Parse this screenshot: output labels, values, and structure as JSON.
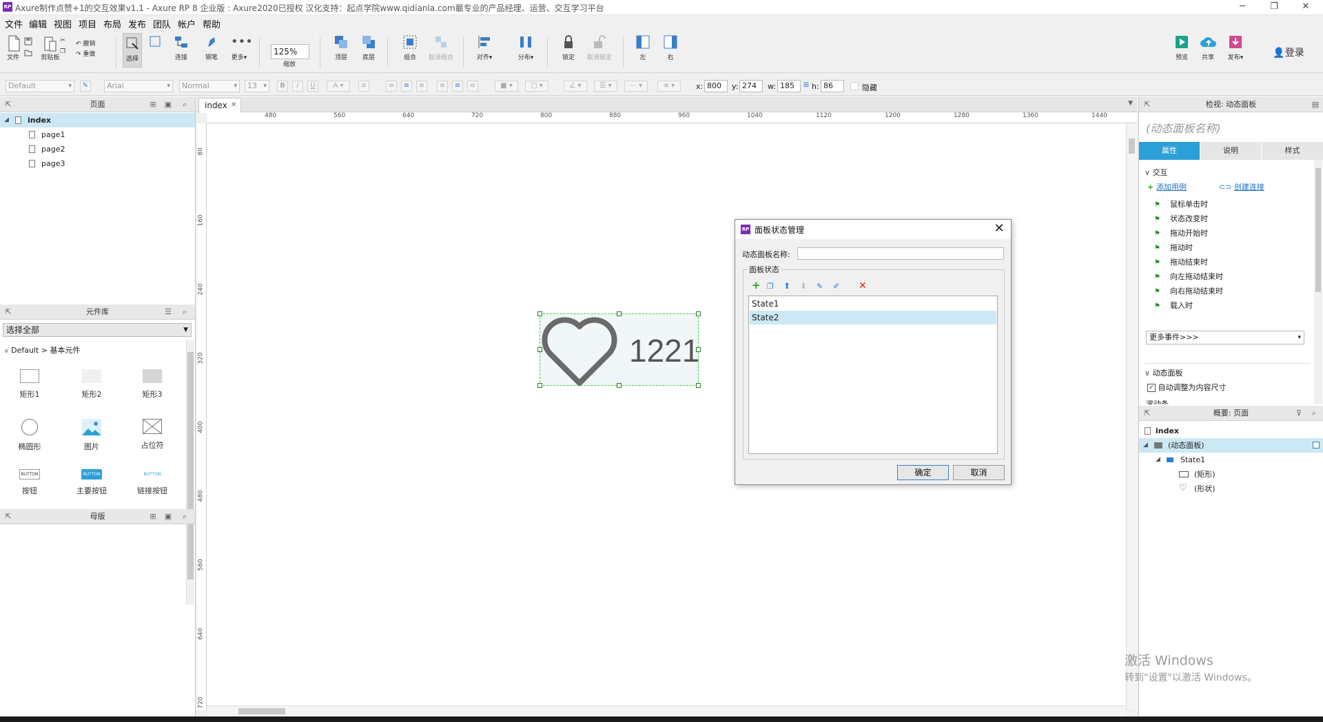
{
  "window": {
    "title": "Axure制作点赞+1的交互效果v1.1 - Axure RP 8 企业版 : Axure2020已授权 汉化支持：起点学院www.qidianla.com最专业的产品经理、运营、交互学习平台",
    "logo": "RP"
  },
  "menu": [
    "文件",
    "编辑",
    "视图",
    "项目",
    "布局",
    "发布",
    "团队",
    "帐户",
    "帮助"
  ],
  "toolbar": {
    "file": "文件",
    "clipboard": "剪贴板",
    "undo": "撤销",
    "redo": "重做",
    "select": "选择",
    "connect": "连接",
    "pen": "钢笔",
    "more": "更多▾",
    "zoom_value": "125%",
    "zoom": "缩放",
    "top": "顶层",
    "bottom": "底层",
    "group": "组合",
    "ungroup": "取消组合",
    "align": "对齐▾",
    "distribute": "分布▾",
    "lock": "锁定",
    "unlock": "取消锁定",
    "left": "左",
    "right": "右",
    "preview": "预览",
    "share": "共享",
    "publish": "发布▾",
    "login": "登录"
  },
  "format": {
    "style": "Default",
    "font": "Arial",
    "weight": "Normal",
    "size": "13",
    "x_label": "x:",
    "x": "800",
    "y_label": "y:",
    "y": "274",
    "w_label": "w:",
    "w": "185",
    "h_label": "h:",
    "h": "86",
    "hidden": "隐藏"
  },
  "pages": {
    "header": "页面",
    "items": [
      "index",
      "page1",
      "page2",
      "page3"
    ]
  },
  "library": {
    "header": "元件库",
    "filter": "选择全部",
    "group": "Default > 基本元件",
    "widgets": [
      "矩形1",
      "矩形2",
      "矩形3",
      "椭圆形",
      "图片",
      "占位符",
      "按钮",
      "主要按钮",
      "链接按钮"
    ],
    "button_text": "BUTTON"
  },
  "masters": {
    "header": "母版"
  },
  "canvas": {
    "tab": "index",
    "ruler_top": [
      "480",
      "560",
      "640",
      "720",
      "800",
      "880",
      "960",
      "1040",
      "1120",
      "1200",
      "1280",
      "1360",
      "1440"
    ],
    "ruler_left": [
      "80",
      "160",
      "240",
      "320",
      "400",
      "480",
      "560",
      "640",
      "720"
    ],
    "like_count": "1221"
  },
  "dialog": {
    "title": "面板状态管理",
    "name_label": "动态面板名称:",
    "name_value": "",
    "group_label": "面板状态",
    "states": [
      "State1",
      "State2"
    ],
    "selected_state": "State2",
    "ok": "确定",
    "cancel": "取消"
  },
  "inspector": {
    "header": "检视: 动态面板",
    "name_placeholder": "(动态面板名称)",
    "tabs": [
      "属性",
      "说明",
      "样式"
    ],
    "interaction": "交互",
    "add_case": "添加用例",
    "create_link": "创建连接",
    "events": [
      "鼠标单击时",
      "状态改变时",
      "拖动开始时",
      "拖动时",
      "拖动结束时",
      "向左拖动结束时",
      "向右拖动结束时",
      "载入时"
    ],
    "more_events": "更多事件>>>",
    "dynamic_panel": "动态面板",
    "auto_fit": "自动调整为内容尺寸",
    "scrollbar_partial": "滚动条"
  },
  "outline": {
    "header": "概要: 页面",
    "page": "index",
    "panel": "(动态面板)",
    "state": "State1",
    "rect": "(矩形)",
    "shape": "(形状)"
  },
  "watermark": {
    "line1": "激活 Windows",
    "line2": "转到\"设置\"以激活 Windows。"
  },
  "colors": {
    "accent": "#2b9fd8",
    "selection": "#cde8f5",
    "handles": "#3bd23b",
    "axure_purple": "#7b2bb8"
  }
}
